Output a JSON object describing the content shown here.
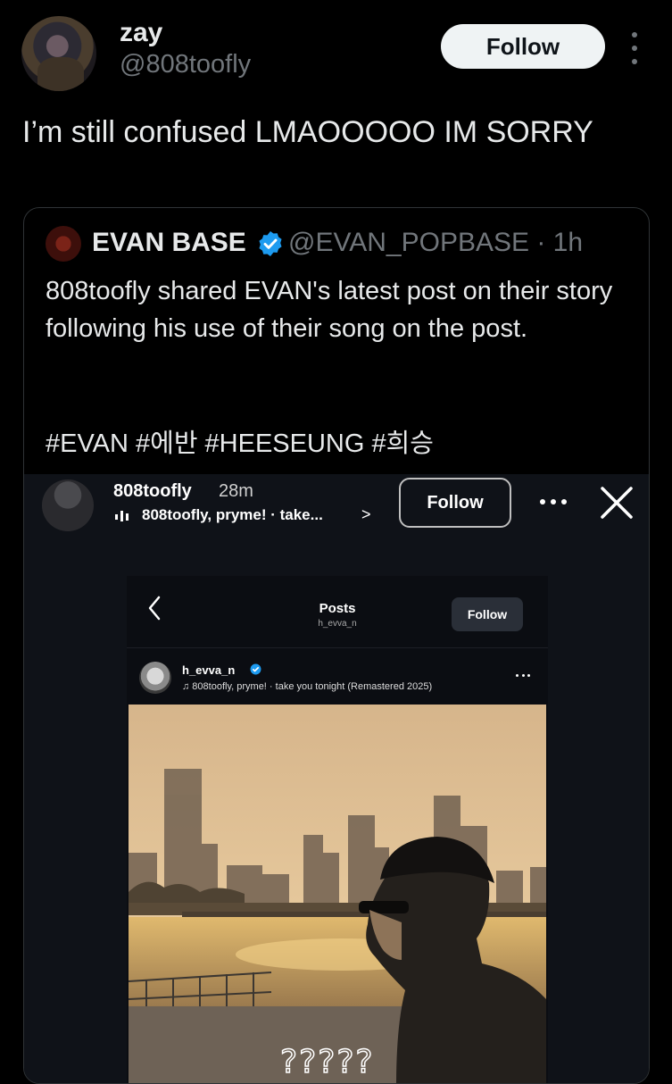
{
  "tweet": {
    "display_name": "zay",
    "handle": "@808toofly",
    "follow_label": "Follow",
    "text": "I’m still confused LMAOOOOO IM SORRY"
  },
  "quote": {
    "name": "EVAN BASE",
    "handle_time": "@EVAN_POPBASE · 1h",
    "text": "808toofly shared EVAN's latest post on their story following his use of their song on the post.",
    "hashtags": "#EVAN #에반 #HEESEUNG #희승",
    "verified_color": "#1d9bf0"
  },
  "story": {
    "user": "808toofly",
    "time": "28m",
    "music": "808toofly, pryme! · take...",
    "music_chevron": ">",
    "follow_label": "Follow",
    "close_icon": "close-icon"
  },
  "inner_post": {
    "title": "Posts",
    "subtitle": "h_evva_n",
    "follow_label": "Follow",
    "user": "h_evva_n",
    "music": "♫  808toofly, pryme! · take you tonight (Remastered 2025)",
    "overlay_text": "?????"
  }
}
